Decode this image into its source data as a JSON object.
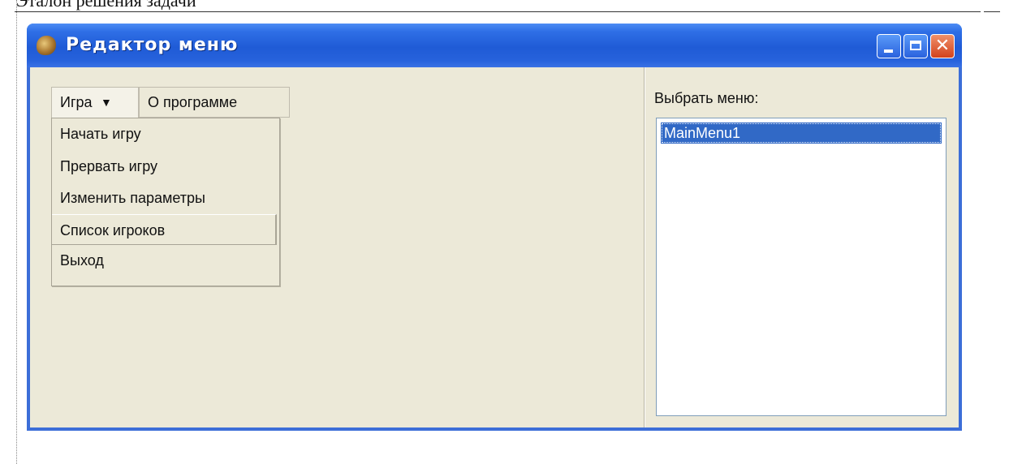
{
  "document": {
    "heading": "Эталон решения задачи"
  },
  "window": {
    "title": "Редактор меню",
    "icon": "app-icon",
    "controls": [
      "minimize-icon",
      "maximize-icon",
      "close-icon"
    ]
  },
  "menubar": {
    "items": [
      {
        "label": "Игра",
        "has_dropdown": true
      },
      {
        "label": "О программе"
      }
    ],
    "dropdown_arrow": "▼"
  },
  "dropdown": {
    "items": [
      {
        "label": "Начать игру"
      },
      {
        "label": "Прервать игру"
      },
      {
        "label": "Изменить параметры"
      },
      {
        "label": "Список игроков",
        "selected": true
      },
      {
        "label": "Выход"
      }
    ]
  },
  "menu_selector": {
    "label": "Выбрать меню:",
    "items": [
      {
        "label": "MainMenu1",
        "selected": true
      }
    ]
  },
  "colors": {
    "titlebar": "#2563dc",
    "client_bg": "#ece9d8",
    "selection": "#3169c6",
    "close_button": "#d2421c"
  }
}
